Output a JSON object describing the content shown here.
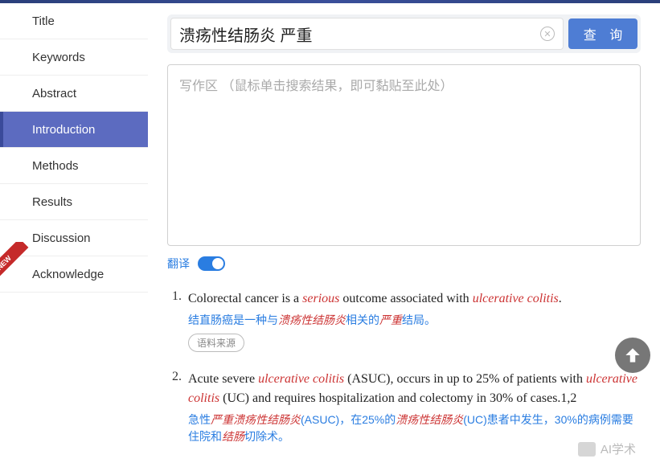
{
  "sidebar": {
    "items": [
      {
        "label": "Title"
      },
      {
        "label": "Keywords"
      },
      {
        "label": "Abstract"
      },
      {
        "label": "Introduction",
        "active": true
      },
      {
        "label": "Methods"
      },
      {
        "label": "Results"
      },
      {
        "label": "Discussion"
      },
      {
        "label": "Acknowledge",
        "badge": "NEW"
      }
    ]
  },
  "search": {
    "value": "溃疡性结肠炎 严重",
    "query_button": "查 询"
  },
  "write_area": {
    "placeholder": "写作区 （鼠标单击搜索结果，即可黏贴至此处）"
  },
  "translate": {
    "label": "翻译",
    "on": true
  },
  "results": [
    {
      "num": "1.",
      "en_parts": [
        {
          "t": "Colorectal cancer is a "
        },
        {
          "t": "serious",
          "hl": true
        },
        {
          "t": " outcome associated with "
        },
        {
          "t": "ulcerative colitis",
          "hl": true
        },
        {
          "t": "."
        }
      ],
      "zh_parts": [
        {
          "t": "结直肠癌是一种与"
        },
        {
          "t": "溃疡性结肠炎",
          "hl": true
        },
        {
          "t": "相关的"
        },
        {
          "t": "严重",
          "hl": true
        },
        {
          "t": "结局。"
        }
      ],
      "source_label": "语料来源"
    },
    {
      "num": "2.",
      "en_parts": [
        {
          "t": "Acute severe "
        },
        {
          "t": "ulcerative colitis",
          "hl": true
        },
        {
          "t": " (ASUC), occurs in up to 25% of patients with "
        },
        {
          "t": "ulcerative colitis",
          "hl": true
        },
        {
          "t": " (UC) and requires hospitalization and colectomy in 30% of cases.1,2"
        }
      ],
      "zh_parts": [
        {
          "t": "急性"
        },
        {
          "t": "严重溃疡性结肠炎",
          "hl": true
        },
        {
          "t": "(ASUC)，在25%的"
        },
        {
          "t": "溃疡性结肠炎",
          "hl": true
        },
        {
          "t": "(UC)患者中发生，30%的病例需要住院和"
        },
        {
          "t": "结肠",
          "hl": true
        },
        {
          "t": "切除术。"
        }
      ]
    }
  ],
  "watermark": "AI学术"
}
